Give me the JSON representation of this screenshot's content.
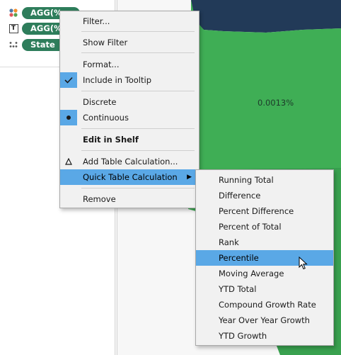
{
  "marks": [
    {
      "icon": "color-icon",
      "pill": "AGG(%..."
    },
    {
      "icon": "label-icon",
      "icon_text": "T",
      "pill": "AGG(%..."
    },
    {
      "icon": "detail-icon",
      "pill": "State"
    }
  ],
  "map": {
    "label": "0.0013%",
    "colors": {
      "land": "#3fae55",
      "water": "#223a58",
      "border": "#2e8a46",
      "background": "#f7f7f7"
    }
  },
  "context_menu": {
    "items": [
      {
        "label": "Filter..."
      },
      {
        "label": "Show Filter"
      },
      {
        "label": "Format..."
      },
      {
        "label": "Include in Tooltip",
        "state": "checked"
      },
      {
        "label": "Discrete"
      },
      {
        "label": "Continuous",
        "state": "selected"
      },
      {
        "label": "Edit in Shelf",
        "bold": true
      },
      {
        "label": "Add Table Calculation...",
        "icon": "delta-icon"
      },
      {
        "label": "Quick Table Calculation",
        "has_submenu": true,
        "highlighted": true
      },
      {
        "label": "Remove"
      }
    ]
  },
  "submenu": {
    "items": [
      {
        "label": "Running Total"
      },
      {
        "label": "Difference"
      },
      {
        "label": "Percent Difference"
      },
      {
        "label": "Percent of Total"
      },
      {
        "label": "Rank"
      },
      {
        "label": "Percentile",
        "highlighted": true
      },
      {
        "label": "Moving Average"
      },
      {
        "label": "YTD Total"
      },
      {
        "label": "Compound Growth Rate"
      },
      {
        "label": "Year Over Year Growth"
      },
      {
        "label": "YTD Growth"
      }
    ]
  }
}
